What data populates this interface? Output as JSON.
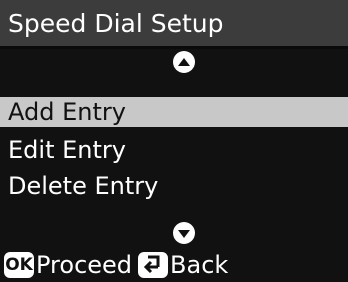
{
  "title_bar": {
    "title": "Speed Dial Setup"
  },
  "scroll": {
    "up_icon": "scroll-up-arrow",
    "down_icon": "scroll-down-arrow"
  },
  "menu": {
    "items": [
      {
        "label": "Add Entry",
        "selected": true
      },
      {
        "label": "Edit Entry",
        "selected": false
      },
      {
        "label": "Delete Entry",
        "selected": false
      }
    ]
  },
  "footer": {
    "ok_key": "OK",
    "ok_action": "Proceed",
    "back_icon": "back-return-arrow",
    "back_action": "Back"
  },
  "colors": {
    "background": "#111111",
    "title_bar": "#3c3c3c",
    "selection": "#c8c8c8",
    "text": "#ffffff"
  }
}
